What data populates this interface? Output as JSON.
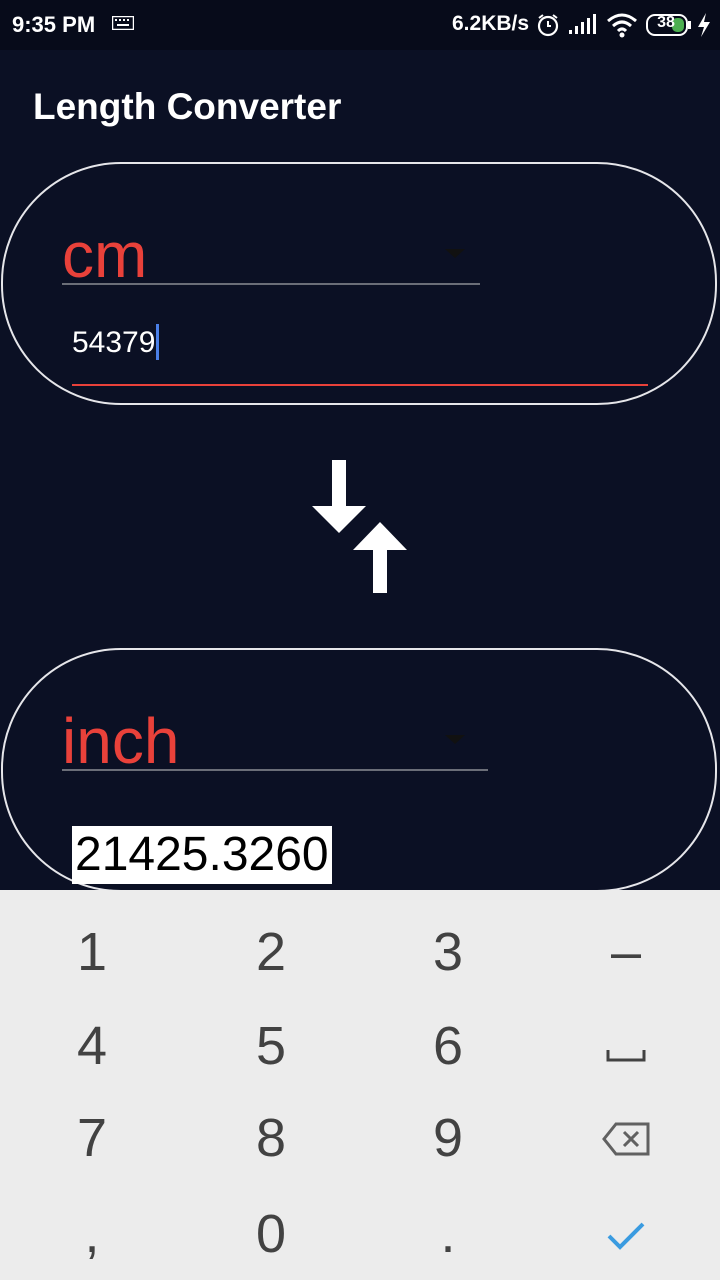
{
  "status_bar": {
    "time": "9:35 PM",
    "speed": "6.2KB/s",
    "battery": "38",
    "icons": [
      "keyboard-icon",
      "alarm-icon",
      "signal-icon",
      "wifi-icon",
      "battery-icon",
      "charging-icon"
    ]
  },
  "app": {
    "title": "Length Converter"
  },
  "from": {
    "unit": "cm",
    "value": "54379"
  },
  "swap": {
    "icon": "swap-arrows-icon"
  },
  "to": {
    "unit": "inch",
    "value": "21425.3260"
  },
  "keyboard": {
    "keys": [
      "1",
      "2",
      "3",
      "–",
      "4",
      "5",
      "6",
      "␣",
      "7",
      "8",
      "9",
      "⌫",
      ",",
      "0",
      ".",
      "✓"
    ],
    "accent": "#3a9be0"
  },
  "colors": {
    "background": "#0b1024",
    "accent_red": "#e9413a",
    "cursor_blue": "#4a7fe8"
  }
}
